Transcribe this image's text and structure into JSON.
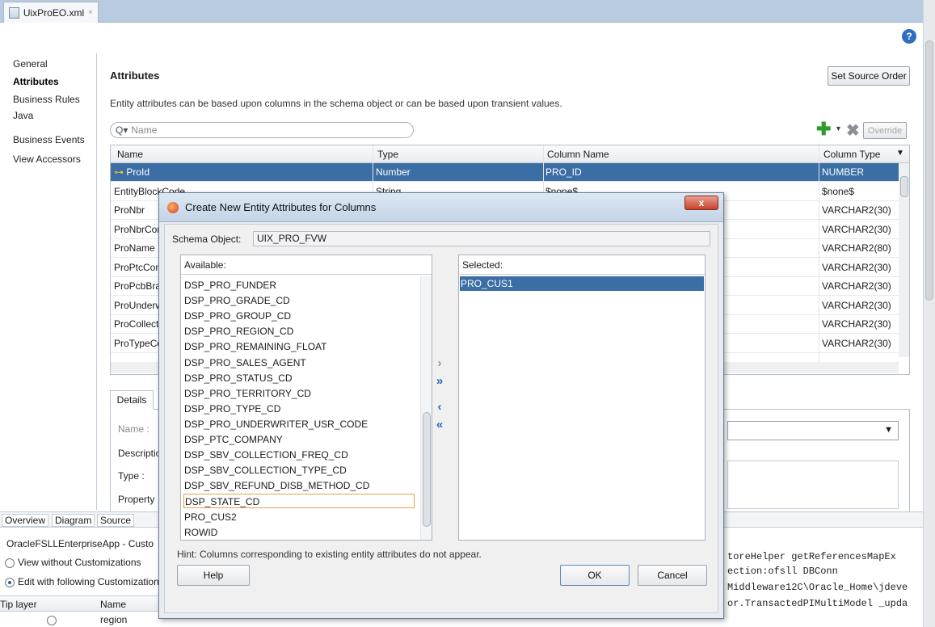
{
  "editor": {
    "tab_label": "UixProEO.xml",
    "tab_close": "×",
    "help_glyph": "?"
  },
  "leftnav": {
    "items": [
      {
        "label": "General",
        "active": false
      },
      {
        "label": "Attributes",
        "active": true
      },
      {
        "label": "Business Rules",
        "active": false
      },
      {
        "label": "Java",
        "active": false
      },
      {
        "label": "Business Events",
        "active": false
      },
      {
        "label": "View Accessors",
        "active": false
      }
    ]
  },
  "main": {
    "heading": "Attributes",
    "set_source_order": "Set Source Order",
    "description": "Entity attributes can be based upon columns in the schema object or can be based upon transient values.",
    "search_placeholder": "Name",
    "override_label": "Override",
    "columns": [
      "Name",
      "Type",
      "Column Name",
      "Column Type"
    ],
    "rows": [
      {
        "name": "ProId",
        "type": "Number",
        "column": "PRO_ID",
        "coltype": "NUMBER",
        "selected": true,
        "key": true
      },
      {
        "name": "EntityBlockCode",
        "type": "String",
        "column": "$none$",
        "coltype": "$none$"
      },
      {
        "name": "ProNbr",
        "type": "",
        "column": "",
        "coltype": "VARCHAR2(30)"
      },
      {
        "name": "ProNbrCon",
        "type": "",
        "column": "",
        "coltype": "VARCHAR2(30)"
      },
      {
        "name": "ProName",
        "type": "",
        "column": "",
        "coltype": "VARCHAR2(80)"
      },
      {
        "name": "ProPtcCom",
        "type": "",
        "column": "",
        "coltype": "VARCHAR2(30)"
      },
      {
        "name": "ProPcbBran",
        "type": "",
        "column": "",
        "coltype": "VARCHAR2(30)"
      },
      {
        "name": "ProUnderw",
        "type": "",
        "column": "",
        "coltype": "VARCHAR2(30)"
      },
      {
        "name": "ProCollecto",
        "type": "",
        "column": "",
        "coltype": "VARCHAR2(30)"
      },
      {
        "name": "ProTypeCd",
        "type": "",
        "column": "",
        "coltype": "VARCHAR2(30)"
      }
    ],
    "details_tab": "Details",
    "details_labels": [
      "Name :",
      "Descriptio",
      "Type :",
      "Property"
    ]
  },
  "overview": {
    "tabs": [
      "Overview",
      "Diagram",
      "Source"
    ]
  },
  "customizations": {
    "title": "OracleFSLLEnterpriseApp - Custo",
    "opt1": "View without Customizations",
    "opt2": "Edit with following Customization",
    "col1": "Tip layer",
    "col2": "Name",
    "row_name": "region"
  },
  "log": {
    "lines": [
      "toreHelper getReferencesMapEx",
      "ection:ofsll DBConn",
      "Middleware12C\\Oracle_Home\\jdeve",
      "or.TransactedPIMultiModel _upda"
    ]
  },
  "dialog": {
    "title": "Create New Entity Attributes for Columns",
    "close_glyph": "x",
    "schema_label": "Schema Object:",
    "schema_value": "UIX_PRO_FVW",
    "available_label": "Available:",
    "selected_label": "Selected:",
    "available": [
      "DSP_PRO_FUNDER",
      "DSP_PRO_GRADE_CD",
      "DSP_PRO_GROUP_CD",
      "DSP_PRO_REGION_CD",
      "DSP_PRO_REMAINING_FLOAT",
      "DSP_PRO_SALES_AGENT",
      "DSP_PRO_STATUS_CD",
      "DSP_PRO_TERRITORY_CD",
      "DSP_PRO_TYPE_CD",
      "DSP_PRO_UNDERWRITER_USR_CODE",
      "DSP_PTC_COMPANY",
      "DSP_SBV_COLLECTION_FREQ_CD",
      "DSP_SBV_COLLECTION_TYPE_CD",
      "DSP_SBV_REFUND_DISB_METHOD_CD",
      "DSP_STATE_CD",
      "PRO_CUS2",
      "ROWID"
    ],
    "focused_available": "DSP_STATE_CD",
    "selected": [
      "PRO_CUS1"
    ],
    "shuttle": {
      "add": "›",
      "add_all": "»",
      "remove": "‹",
      "remove_all": "«"
    },
    "hint": "Hint: Columns corresponding to existing entity attributes do not appear.",
    "help_button": "Help",
    "ok_button": "OK",
    "cancel_button": "Cancel"
  }
}
